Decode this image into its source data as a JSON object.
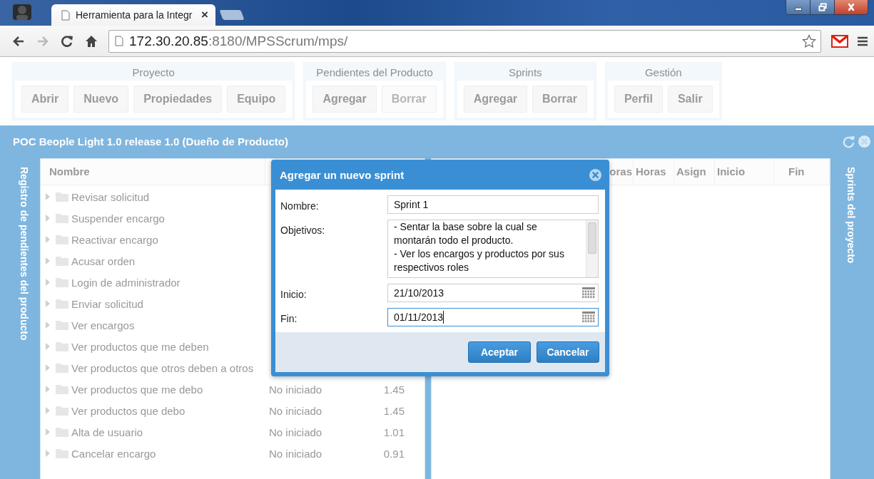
{
  "browser": {
    "tab": {
      "title": "Herramienta para la Integr",
      "close": "×"
    },
    "url": {
      "host": "172.30.20.85",
      "rest": ":8180/MPSScrum/mps/"
    }
  },
  "toolbar_groups": [
    {
      "title": "Proyecto",
      "buttons": [
        {
          "label": "Abrir",
          "disabled": false
        },
        {
          "label": "Nuevo",
          "disabled": false
        },
        {
          "label": "Propiedades",
          "disabled": false
        },
        {
          "label": "Equipo",
          "disabled": false
        }
      ]
    },
    {
      "title": "Pendientes del Producto",
      "buttons": [
        {
          "label": "Agregar",
          "disabled": false
        },
        {
          "label": "Borrar",
          "disabled": true
        }
      ]
    },
    {
      "title": "Sprints",
      "buttons": [
        {
          "label": "Agregar",
          "disabled": false
        },
        {
          "label": "Borrar",
          "disabled": false
        }
      ]
    },
    {
      "title": "Gestión",
      "buttons": [
        {
          "label": "Perfil",
          "disabled": false
        },
        {
          "label": "Salir",
          "disabled": false
        }
      ]
    }
  ],
  "panel": {
    "title": "POC Beople Light 1.0 release 1.0 (Dueño de Producto)",
    "left_sidebar": "Registro de pendientes del producto",
    "backlog": {
      "columns": [
        "Nombre"
      ],
      "rows": [
        {
          "name": "Revisar solicitud"
        },
        {
          "name": "Suspender encargo"
        },
        {
          "name": "Reactivar encargo"
        },
        {
          "name": "Acusar orden"
        },
        {
          "name": "Login de administrador"
        },
        {
          "name": "Enviar solicitud"
        },
        {
          "name": "Ver encargos"
        },
        {
          "name": "Ver productos que me deben"
        },
        {
          "name": "Ver productos que otros deben a otros"
        },
        {
          "name": "Ver productos que me debo",
          "status": "No iniciado",
          "value": "1.45"
        },
        {
          "name": "Ver productos que debo",
          "status": "No iniciado",
          "value": "1.45"
        },
        {
          "name": "Alta de usuario",
          "status": "No iniciado",
          "value": "1.01"
        },
        {
          "name": "Cancelar encargo",
          "status": "No iniciado",
          "value": "0.91"
        }
      ]
    },
    "sprints": {
      "columns": [
        "oras",
        "Horas",
        "Asign",
        "Inicio",
        "Fin"
      ]
    },
    "right_sidebar": "Sprints del proyecto"
  },
  "dialog": {
    "title": "Agregar un nuevo sprint",
    "fields": [
      {
        "kind": "text",
        "label": "Nombre:",
        "value": "Sprint 1",
        "focused": false
      },
      {
        "kind": "textarea",
        "label": "Objetivos:",
        "value": "- Sentar la base sobre la cual se montarán todo el producto.\n- Ver los encargos y productos por sus respectivos roles",
        "focused": false
      },
      {
        "kind": "date",
        "label": "Inicio:",
        "value": "21/10/2013",
        "focused": false
      },
      {
        "kind": "date",
        "label": "Fin:",
        "value": "01/11/2013",
        "focused": true
      }
    ],
    "buttons": [
      "Aceptar",
      "Cancelar"
    ]
  }
}
